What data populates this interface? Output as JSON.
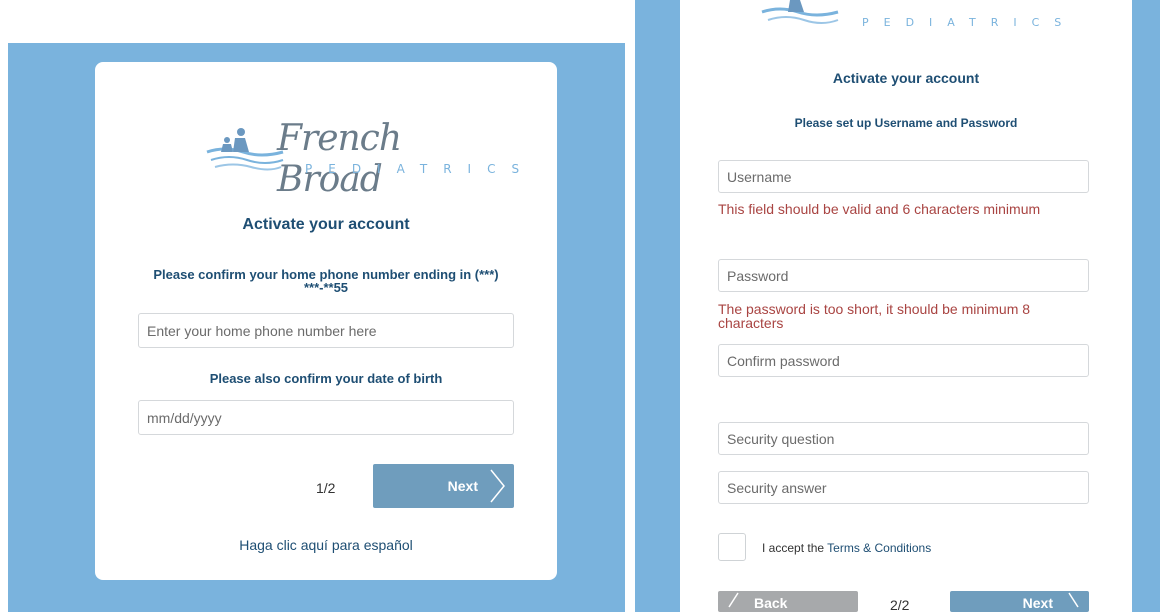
{
  "left": {
    "logo": {
      "word": "French Broad",
      "sub": "PEDIATRICS"
    },
    "title": "Activate your account",
    "phone_prompt_line1": "Please confirm your home phone number ending in (***)",
    "phone_prompt_line2": "***-**55",
    "phone_placeholder": "Enter your home phone number here",
    "dob_prompt": "Please also confirm your date of birth",
    "dob_placeholder": "mm/dd/yyyy",
    "step": "1/2",
    "next_label": "Next",
    "spanish_link": "Haga clic aquí para español"
  },
  "right": {
    "logo_sub": "PEDIATRICS",
    "title": "Activate your account",
    "subtitle": "Please set up Username and Password",
    "username_placeholder": "Username",
    "username_error": "This field should be valid and 6 characters minimum",
    "password_placeholder": "Password",
    "password_error_line1": "The password is too short, it should be minimum 8",
    "password_error_line2": "characters",
    "confirm_placeholder": "Confirm password",
    "security_question_placeholder": "Security question",
    "security_answer_placeholder": "Security answer",
    "terms_prefix": "I accept the ",
    "terms_link": "Terms & Conditions",
    "back_label": "Back",
    "step": "2/2",
    "next_label": "Next"
  },
  "colors": {
    "background_blue": "#7ab3dd",
    "title_navy": "#1e4e73",
    "button_blue": "#6f9dbd",
    "error_red": "#a94442",
    "back_gray": "#a7a9ab"
  }
}
